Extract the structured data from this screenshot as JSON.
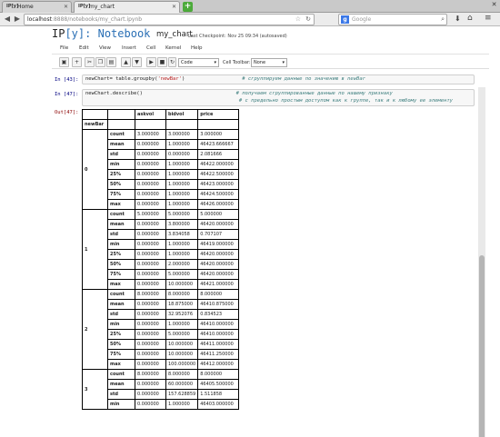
{
  "browser": {
    "tabs": [
      {
        "icon": "IP[y]",
        "label": "Home"
      },
      {
        "icon": "IP[y]",
        "label": "my_chart"
      }
    ],
    "url_host": "localhost",
    "url_path": ":8888/notebooks/my_chart.ipynb",
    "search_placeholder": "Google"
  },
  "notebook": {
    "logo_prefix": "IP",
    "logo_bracket": "[y]",
    "logo_suffix": ": Notebook",
    "title": "my_chart",
    "checkpoint": "Last Checkpoint: Nov 25 09:34 (autosaved)",
    "menu": [
      "File",
      "Edit",
      "View",
      "Insert",
      "Cell",
      "Kernel",
      "Help"
    ],
    "cell_type": "Code",
    "cell_toolbar_label": "Cell Toolbar:",
    "cell_toolbar_value": "None"
  },
  "cells": [
    {
      "prompt": "In [43]:",
      "code": "newChart= table.groupby(",
      "code_str": "'newBar'",
      "code_end": ")",
      "comment": "# сгруппируем данные по значению в newBar"
    },
    {
      "prompt": "In [47]:",
      "code": "newChart.describe()",
      "comment": "# получаем сгруппированные данные по нашему признаку",
      "comment2": "# с предельно простым доступом как к группе, так и к любому ее элементу"
    }
  ],
  "output": {
    "prompt": "Out[47]:",
    "columns": [
      "askvol",
      "bidvol",
      "price"
    ],
    "index_name": "newBar",
    "groups": [
      {
        "key": "0",
        "rows": [
          [
            "count",
            "3.000000",
            "3.000000",
            "3.000000"
          ],
          [
            "mean",
            "0.000000",
            "1.000000",
            "46423.666667"
          ],
          [
            "std",
            "0.000000",
            "0.000000",
            "2.081666"
          ],
          [
            "min",
            "0.000000",
            "1.000000",
            "46422.000000"
          ],
          [
            "25%",
            "0.000000",
            "1.000000",
            "46422.500000"
          ],
          [
            "50%",
            "0.000000",
            "1.000000",
            "46423.000000"
          ],
          [
            "75%",
            "0.000000",
            "1.000000",
            "46424.500000"
          ],
          [
            "max",
            "0.000000",
            "1.000000",
            "46426.000000"
          ]
        ]
      },
      {
        "key": "1",
        "rows": [
          [
            "count",
            "5.000000",
            "5.000000",
            "5.000000"
          ],
          [
            "mean",
            "0.000000",
            "3.800000",
            "46420.000000"
          ],
          [
            "std",
            "0.000000",
            "3.834058",
            "0.707107"
          ],
          [
            "min",
            "0.000000",
            "1.000000",
            "46419.000000"
          ],
          [
            "25%",
            "0.000000",
            "1.000000",
            "46420.000000"
          ],
          [
            "50%",
            "0.000000",
            "2.000000",
            "46420.000000"
          ],
          [
            "75%",
            "0.000000",
            "5.000000",
            "46420.000000"
          ],
          [
            "max",
            "0.000000",
            "10.000000",
            "46421.000000"
          ]
        ]
      },
      {
        "key": "2",
        "rows": [
          [
            "count",
            "8.000000",
            "8.000000",
            "8.000000"
          ],
          [
            "mean",
            "0.000000",
            "18.875000",
            "46410.875000"
          ],
          [
            "std",
            "0.000000",
            "32.952076",
            "0.834523"
          ],
          [
            "min",
            "0.000000",
            "1.000000",
            "46410.000000"
          ],
          [
            "25%",
            "0.000000",
            "5.000000",
            "46410.000000"
          ],
          [
            "50%",
            "0.000000",
            "10.000000",
            "46411.000000"
          ],
          [
            "75%",
            "0.000000",
            "10.000000",
            "46411.250000"
          ],
          [
            "max",
            "0.000000",
            "100.000000",
            "46412.000000"
          ]
        ]
      },
      {
        "key": "3",
        "rows": [
          [
            "count",
            "8.000000",
            "8.000000",
            "8.000000"
          ],
          [
            "mean",
            "0.000000",
            "60.000000",
            "46405.500000"
          ],
          [
            "std",
            "0.000000",
            "157.628859",
            "1.511858"
          ],
          [
            "min",
            "0.000000",
            "1.000000",
            "46403.000000"
          ]
        ]
      }
    ]
  }
}
